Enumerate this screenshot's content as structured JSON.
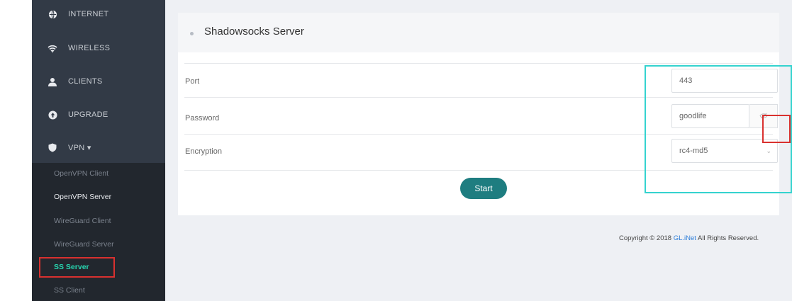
{
  "sidebar": {
    "nav": [
      {
        "label": "INTERNET",
        "icon": "globe-icon"
      },
      {
        "label": "WIRELESS",
        "icon": "wifi-icon"
      },
      {
        "label": "CLIENTS",
        "icon": "user-icon"
      },
      {
        "label": "UPGRADE",
        "icon": "upgrade-icon"
      },
      {
        "label": "VPN ▾",
        "icon": "shield-icon"
      }
    ],
    "vpn_submenu": [
      {
        "label": "OpenVPN Client"
      },
      {
        "label": "OpenVPN Server"
      },
      {
        "label": "WireGuard Client"
      },
      {
        "label": "WireGuard Server"
      },
      {
        "label": "SS Server"
      },
      {
        "label": "SS Client"
      }
    ]
  },
  "panel": {
    "title": "Shadowsocks Server",
    "fields": {
      "port": {
        "label": "Port",
        "value": "443"
      },
      "password": {
        "label": "Password",
        "value": "goodlife"
      },
      "encryption": {
        "label": "Encryption",
        "value": "rc4-md5"
      }
    },
    "start_label": "Start"
  },
  "footer": {
    "prefix": "Copyright © 2018 ",
    "link": "GL.iNet",
    "suffix": " All Rights Reserved."
  },
  "colors": {
    "sidebar_bg": "#323a46",
    "submenu_bg": "#22272e",
    "accent_teal": "#1e7d80",
    "active_green": "#27d6b0",
    "highlight_red": "#d9312f",
    "highlight_cyan": "#34d3cf"
  }
}
